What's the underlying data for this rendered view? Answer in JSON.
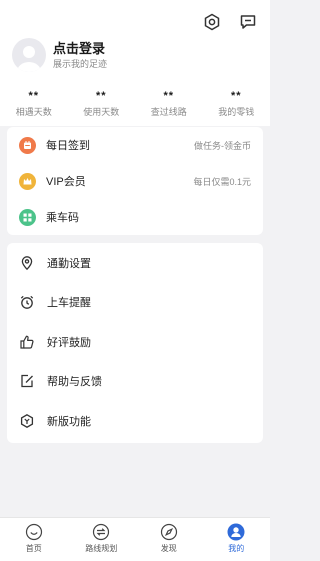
{
  "header": {
    "login_title": "点击登录",
    "login_subtitle": "展示我的足迹",
    "icons": [
      "settings-icon",
      "message-icon"
    ]
  },
  "stats": [
    {
      "value": "**",
      "label": "相遇天数"
    },
    {
      "value": "**",
      "label": "使用天数"
    },
    {
      "value": "**",
      "label": "查过线路"
    },
    {
      "value": "**",
      "label": "我的零钱"
    }
  ],
  "services": [
    {
      "label": "每日签到",
      "right": "做任务-领金币",
      "icon": "signin-icon",
      "color": "#f07a4a"
    },
    {
      "label": "VIP会员",
      "right": "每日仅需0.1元",
      "icon": "vip-crown-icon",
      "color": "#f0b43a"
    },
    {
      "label": "乘车码",
      "right": "",
      "icon": "ride-code-icon",
      "color": "#4cc38a"
    }
  ],
  "menu": [
    {
      "label": "通勤设置",
      "icon": "location-pin-icon"
    },
    {
      "label": "上车提醒",
      "icon": "alarm-clock-icon"
    },
    {
      "label": "好评鼓励",
      "icon": "thumbs-up-icon"
    },
    {
      "label": "帮助与反馈",
      "icon": "feedback-edit-icon"
    },
    {
      "label": "新版功能",
      "icon": "new-feature-icon"
    }
  ],
  "tabbar": [
    {
      "label": "首页",
      "icon": "home-smile-icon",
      "active": false
    },
    {
      "label": "路线规划",
      "icon": "route-plan-icon",
      "active": false
    },
    {
      "label": "发现",
      "icon": "compass-icon",
      "active": false
    },
    {
      "label": "我的",
      "icon": "user-icon",
      "active": true
    }
  ],
  "colors": {
    "accent": "#2f6ad9",
    "background": "#f2f2f4"
  }
}
